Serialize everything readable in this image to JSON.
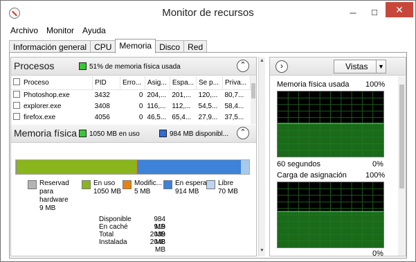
{
  "window": {
    "title": "Monitor de recursos",
    "minimize": "─",
    "maximize": "☐",
    "close": "✕"
  },
  "menu": [
    "Archivo",
    "Monitor",
    "Ayuda"
  ],
  "tabs": [
    "Información general",
    "CPU",
    "Memoria",
    "Disco",
    "Red"
  ],
  "active_tab": "Memoria",
  "processes": {
    "title": "Procesos",
    "summary": "51% de memoria física usada",
    "columns": [
      "Proceso",
      "PID",
      "Erro...",
      "Asig...",
      "Espa...",
      "Se p...",
      "Priva..."
    ],
    "rows": [
      [
        "Photoshop.exe",
        "3432",
        "0",
        "204,...",
        "201,...",
        "120,...",
        "80,7..."
      ],
      [
        "explorer.exe",
        "3408",
        "0",
        "116,...",
        "112,...",
        "54,5...",
        "58,4..."
      ],
      [
        "firefox.exe",
        "4056",
        "0",
        "46,5...",
        "65,4...",
        "27,9...",
        "37,5..."
      ]
    ]
  },
  "physical_memory": {
    "title": "Memoria física",
    "in_use_label": "1050 MB en uso",
    "available_label": "984 MB disponibl...",
    "bar": [
      {
        "name": "Reservado para hardware",
        "fraction": 0.004,
        "color": "#8c8c8c"
      },
      {
        "name": "En uso",
        "fraction": 0.513,
        "color": "#8ab51d"
      },
      {
        "name": "Modificado",
        "fraction": 0.002,
        "color": "#e8820c"
      },
      {
        "name": "En espera",
        "fraction": 0.446,
        "color": "#3e82d9"
      },
      {
        "name": "Libre",
        "fraction": 0.035,
        "color": "#a9c9ec"
      }
    ],
    "legend": [
      {
        "label": "Reservad para hardware",
        "value": "9 MB",
        "color": "#b4b4b4"
      },
      {
        "label": "En uso",
        "value": "1050 MB",
        "color": "#8ab51d"
      },
      {
        "label": "Modific...",
        "value": "5 MB",
        "color": "#e8820c"
      },
      {
        "label": "En espera",
        "value": "914 MB",
        "color": "#3e82d9"
      },
      {
        "label": "Libre",
        "value": "70 MB",
        "color": "#bcd6f2"
      }
    ],
    "stats": [
      {
        "label": "Disponible",
        "value": "984 MB"
      },
      {
        "label": "En caché",
        "value": "919 MB"
      },
      {
        "label": "Total",
        "value": "2039 MB"
      },
      {
        "label": "Instalada",
        "value": "2048 MB"
      }
    ]
  },
  "right_panel": {
    "views_button": "Vistas",
    "expand_icon": "›",
    "graph1": {
      "title": "Memoria física usada",
      "max": "100%",
      "time": "60 segundos",
      "min": "0%",
      "level": 0.51
    },
    "graph2": {
      "title": "Carga de asignación",
      "max": "100%",
      "min": "0%",
      "level": 0.55
    }
  },
  "colors": {
    "graph_line": "#35c435",
    "graph_fill": "#1f7d1f",
    "graph_grid": "#1e5a1e"
  }
}
